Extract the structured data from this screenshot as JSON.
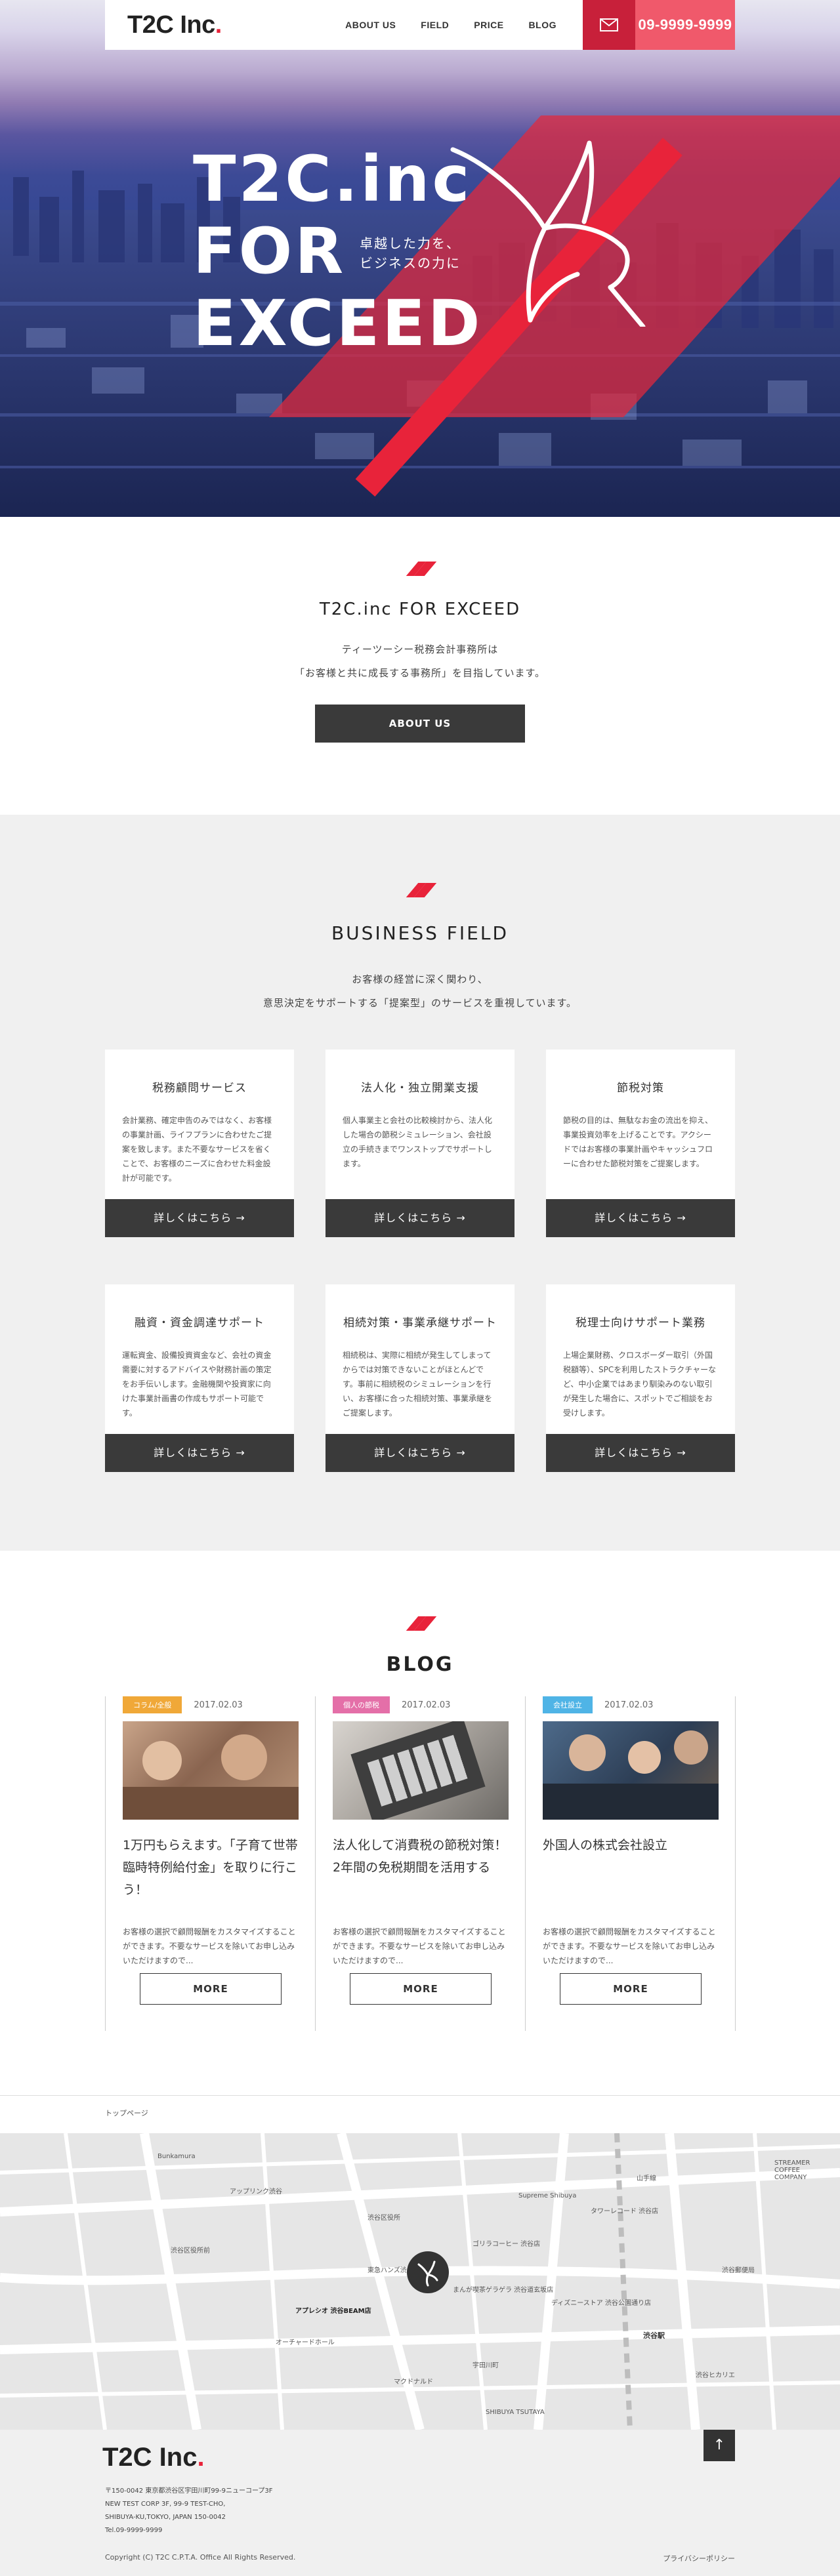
{
  "header": {
    "logo_main": "T2C Inc",
    "logo_dot": ".",
    "nav": [
      "ABOUT US",
      "FIELD",
      "PRICE",
      "BLOG"
    ],
    "mail_icon": "mail-icon",
    "phone": "09-9999-9999"
  },
  "hero": {
    "title_line1": "T2C.inc",
    "title_line2": "FOR",
    "title_line3": "EXCEED",
    "sub_line1": "卓越した力を、",
    "sub_line2": "ビジネスの力に"
  },
  "about": {
    "heading": "T2C.inc FOR EXCEED",
    "line1": "ティーツーシー税務会計事務所は",
    "line2": "「お客様と共に成長する事務所」を目指しています。",
    "button": "ABOUT US"
  },
  "field": {
    "heading": "BUSINESS FIELD",
    "lead1": "お客様の経営に深く関わり、",
    "lead2": "意思決定をサポートする「提案型」のサービスを重視しています。",
    "cards": [
      {
        "title": "税務顧問サービス",
        "text": "会計業務、確定申告のみではなく、お客様の事業計画、ライフプランに合わせたご提案を致します。また不要なサービスを省くことで、お客様のニーズに合わせた料金設計が可能です。",
        "more": "詳しくはこちら →"
      },
      {
        "title": "法人化・独立開業支援",
        "text": "個人事業主と会社の比較検討から、法人化した場合の節税シミュレーション、会社設立の手続きまでワンストップでサポートします。",
        "more": "詳しくはこちら →"
      },
      {
        "title": "節税対策",
        "text": "節税の目的は、無駄なお金の流出を抑え、事業投資効率を上げることです。アクシードではお客様の事業計画やキャッシュフローに合わせた節税対策をご提案します。",
        "more": "詳しくはこちら →"
      },
      {
        "title": "融資・資金調達サポート",
        "text": "運転資金、設備投資資金など、会社の資金需要に対するアドバイスや財務計画の策定をお手伝いします。金融機関や投資家に向けた事業計画書の作成もサポート可能です。",
        "more": "詳しくはこちら →"
      },
      {
        "title": "相続対策・事業承継サポート",
        "text": "相続税は、実際に相続が発生してしまってからでは対策できないことがほとんどです。事前に相続税のシミュレーションを行い、お客様に合った相続対策、事業承継をご提案します。",
        "more": "詳しくはこちら →"
      },
      {
        "title": "税理士向けサポート業務",
        "text": "上場企業財務、クロスボーダー取引（外国税額等）、SPCを利用したストラクチャーなど、中小企業ではあまり馴染みのない取引が発生した場合に、スポットでご相談をお受けします。",
        "more": "詳しくはこちら →"
      }
    ]
  },
  "blog": {
    "heading": "BLOG",
    "posts": [
      {
        "cat": "コラム/全般",
        "cat_color": "#f0a838",
        "date": "2017.02.03",
        "title": "1万円もらえます。「子育て世帯臨時特例給付金」を取りに行こう！",
        "text": "お客様の選択で顧問報酬をカスタマイズすることができます。不要なサービスを除いてお申し込みいただけますので...",
        "more": "MORE"
      },
      {
        "cat": "個人の節税",
        "cat_color": "#e46fa8",
        "date": "2017.02.03",
        "title": "法人化して消費税の節税対策！2年間の免税期間を活用する",
        "text": "お客様の選択で顧問報酬をカスタマイズすることができます。不要なサービスを除いてお申し込みいただけますので...",
        "more": "MORE"
      },
      {
        "cat": "会社設立",
        "cat_color": "#4fb4e6",
        "date": "2017.02.03",
        "title": "外国人の株式会社設立",
        "text": "お客様の選択で顧問報酬をカスタマイズすることができます。不要なサービスを除いてお申し込みいただけますので...",
        "more": "MORE"
      }
    ]
  },
  "breadcrumb": "トップページ",
  "map_labels": [
    "Bunkamura",
    "アップリンク渋谷",
    "東急ハンズ渋谷店",
    "まんが喫茶ゲラゲラ 渋谷道玄坂店",
    "アプレシオ 渋谷BEAM店",
    "オーチャードホール",
    "渋谷区役所",
    "Supreme Shibuya",
    "ディズニーストア 渋谷公園通り店",
    "マクドナルド",
    "宇田川町",
    "SHIBUYA TSUTAYA",
    "渋谷ヒカリエ",
    "タワーレコード 渋谷店",
    "ゴリラコーヒー 渋谷店",
    "渋谷郵便局",
    "STREAMER COFFEE COMPANY",
    "渋谷駅",
    "山手線",
    "渋谷区役所前"
  ],
  "footer": {
    "logo_main": "T2C Inc",
    "logo_dot": ".",
    "addr1": "〒150-0042 東京都渋谷区宇田川町99-9ニューコープ3F",
    "addr2": "NEW TEST CORP 3F, 99-9 TEST-CHO,",
    "addr3": "SHIBUYA-KU,TOKYO, JAPAN 150-0042",
    "tel": "Tel.09-9999-9999",
    "copy": "Copyright (C) T2C C.P.T.A. Office All Rights Reserved.",
    "privacy": "プライバシーポリシー",
    "totop": "↑"
  },
  "colors": {
    "accent": "#e8233a",
    "dark": "#3a3a3a",
    "field_bg": "#f0f0f0"
  }
}
